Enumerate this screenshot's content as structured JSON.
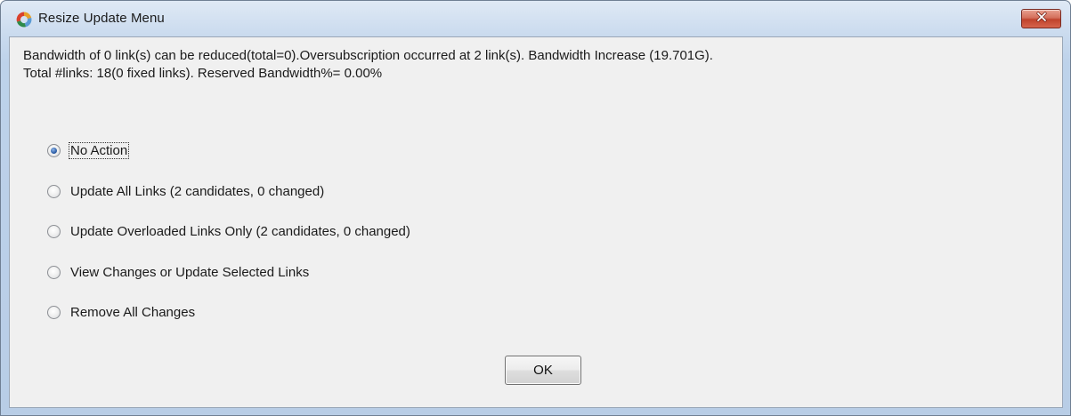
{
  "window": {
    "title": "Resize Update Menu",
    "close_icon": "close-icon"
  },
  "message": {
    "line1": "Bandwidth of 0 link(s) can be reduced(total=0).Oversubscription occurred at 2 link(s). Bandwidth Increase (19.701G).",
    "line2": "Total #links: 18(0 fixed links). Reserved Bandwidth%= 0.00%"
  },
  "options": [
    {
      "label": "No Action",
      "checked": true
    },
    {
      "label": "Update All Links (2 candidates, 0 changed)",
      "checked": false
    },
    {
      "label": "Update Overloaded Links Only (2 candidates, 0 changed)",
      "checked": false
    },
    {
      "label": "View Changes or Update Selected Links",
      "checked": false
    },
    {
      "label": "Remove All Changes",
      "checked": false
    }
  ],
  "buttons": {
    "ok_label": "OK"
  }
}
